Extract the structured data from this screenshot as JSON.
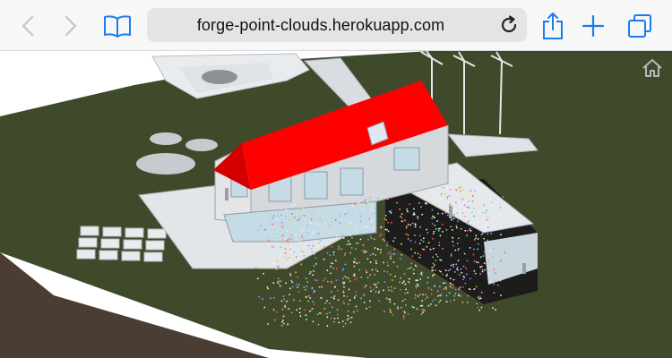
{
  "browser": {
    "url": "forge-point-clouds.herokuapp.com",
    "icons": {
      "back": "chevron-left-icon",
      "forward": "chevron-right-icon",
      "bookmarks": "open-book-icon",
      "reload": "reload-icon",
      "share": "share-icon",
      "new_tab": "plus-icon",
      "tabs": "tabs-icon"
    },
    "accent_color": "#1a7cf5",
    "disabled_color": "#c6c6c8"
  },
  "viewer": {
    "home_icon": "home-icon",
    "colors": {
      "sky": "#ffffff",
      "grass": "#3f4a2b",
      "roof": "#ff0000",
      "walls": "#d9d9d9",
      "glass": "#cfe0ea",
      "annex": "#1c1c1c"
    }
  }
}
